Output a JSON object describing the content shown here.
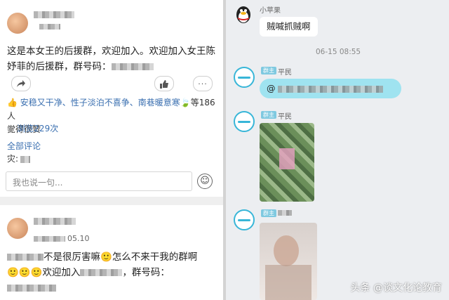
{
  "left_post1": {
    "text_line1": "这是本女王的后援群，欢迎加入。欢迎加入女王陈",
    "text_line2": "妤菲的后援群，群号码：",
    "likes_names": "安稳又干净、性子淡泊不喜争、南巷暖意寒",
    "likes_suffix": "等186人",
    "likes_line2": "觉得很赞",
    "views": "浏览229次",
    "all_comments": "全部评论",
    "comment_prefix": "灾:",
    "comment_placeholder": "我也说一句..."
  },
  "left_post2": {
    "date": "05.10",
    "text_line1": "不是很厉害嘛",
    "text_line1b": "怎么不来干我的群啊",
    "text_line2a": "欢迎加入",
    "text_line2b": "，群号码："
  },
  "right_chat": {
    "sender1_name": "小苹果",
    "msg1": "贼喊抓贼啊",
    "timestamp": "06-15 08:55",
    "sender2_badge": "群主",
    "sender2_name": "平民",
    "msg2_prefix": "@"
  },
  "watermark": "头条 @谈文化论教育",
  "colors": {
    "link": "#3a6fb0",
    "bubble_highlight": "#9fe3f0",
    "accent": "#38b6d8"
  },
  "icons": [
    "share-icon",
    "thumb-up-icon",
    "more-icon",
    "emoji-icon",
    "qq-penguin-icon"
  ]
}
